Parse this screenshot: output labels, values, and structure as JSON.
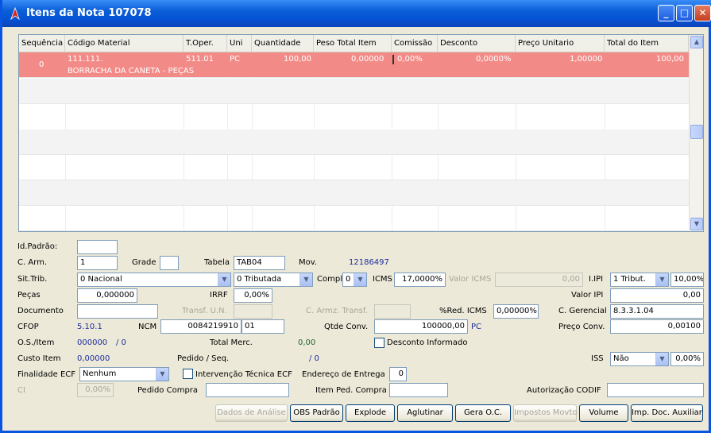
{
  "window": {
    "title": "Itens da Nota 107078"
  },
  "grid": {
    "headers": [
      "Sequência",
      "Código Material",
      "T.Oper.",
      "Uni",
      "Quantidade",
      "Peso Total Item",
      "Comissão",
      "Desconto",
      "Preço Unitario",
      "Total do Item"
    ],
    "row": {
      "seq": "0",
      "codigo": "111.111.",
      "descricao": "BORRACHA DA CANETA - PEÇAS",
      "toper": "511.01",
      "uni": "PC",
      "quantidade": "100,00",
      "peso": "0,00000",
      "comissao": "0,00%",
      "desconto": "0,0000%",
      "preco": "1,00000",
      "total": "100,00"
    }
  },
  "form": {
    "id_padrao_label": "Id.Padrão:",
    "id_padrao": "",
    "c_arm_label": "C. Arm.",
    "c_arm": "1",
    "grade_label": "Grade",
    "grade": "",
    "tabela_label": "Tabela",
    "tabela": "TAB04",
    "mov_label": "Mov.",
    "mov": "12186497",
    "sit_trib_label": "Sit.Trib.",
    "sit_trib": "0 Nacional",
    "sit_trib2": "0 Tributada",
    "compl_label": "Compl",
    "compl": "0",
    "icms_label": "ICMS",
    "icms": "17,0000%",
    "valor_icms_label": "Valor ICMS",
    "valor_icms": "0,00",
    "ipi_label": "I.IPI",
    "ipi": "1 Tribut.",
    "ipi_pct": "10,00%",
    "pecas_label": "Peças",
    "pecas": "0,000000",
    "irrf_label": "IRRF",
    "irrf": "0,00%",
    "valor_ipi_label": "Valor IPI",
    "valor_ipi": "0,00",
    "documento_label": "Documento",
    "documento": "",
    "transf_un_label": "Transf. U.N.",
    "transf_un": "",
    "c_armz_label": "C. Armz. Transf.",
    "c_armz": "",
    "red_icms_label": "%Red. ICMS",
    "red_icms": "0,00000%",
    "c_gerencial_label": "C. Gerencial",
    "c_gerencial": "8.3.3.1.04",
    "cfop_label": "CFOP",
    "cfop": "5.10.1",
    "ncm_label": "NCM",
    "ncm": "0084219910",
    "ncm2": "01",
    "qtde_conv_label": "Qtde Conv.",
    "qtde_conv": "100000,00",
    "qtde_unit": "PC",
    "preco_conv_label": "Preço Conv.",
    "preco_conv": "0,00100",
    "os_item_label": "O.S./Item",
    "os_item": "000000",
    "os_item2": "/ 0",
    "total_merc_label": "Total Merc.",
    "total_merc": "0,00",
    "desconto_informado_label": "Desconto Informado",
    "custo_item_label": "Custo Item",
    "custo_item": "0,00000",
    "pedido_seq_label": "Pedido / Seq.",
    "pedido_seq": "/ 0",
    "iss_label": "ISS",
    "iss": "Não",
    "iss_pct": "0,00%",
    "finalidade_label": "Finalidade ECF",
    "finalidade": "Nenhum",
    "intervencao_label": "Intervenção Técnica ECF",
    "endereco_label": "Endereço de Entrega",
    "endereco": "0",
    "ci_label": "CI",
    "ci": "0,00%",
    "pedido_compra_label": "Pedido Compra",
    "pedido_compra": "",
    "item_ped_label": "Item Ped. Compra",
    "item_ped": "",
    "autorizacao_label": "Autorização CODIF",
    "autorizacao": ""
  },
  "buttons": {
    "dados": "Dados de Análise",
    "obs": "OBS Padrão",
    "explode": "Explode",
    "aglutinar": "Aglutinar",
    "gera": "Gera O.C.",
    "impostos": "Impostos Movto",
    "volume": "Volume",
    "imp_doc": "Imp. Doc. Auxiliar"
  },
  "colors": {
    "selected_row": "#f28b87",
    "titlebar": "#0a5ed6"
  }
}
